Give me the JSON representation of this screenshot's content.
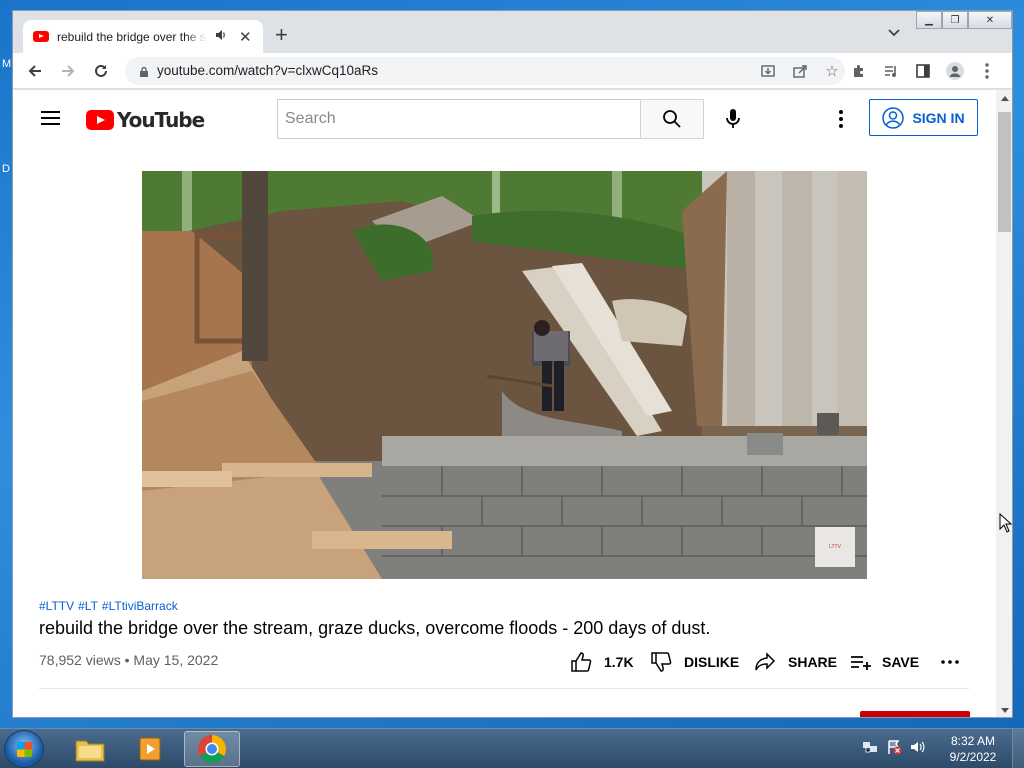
{
  "desktop": {
    "letters": [
      "M",
      "D"
    ]
  },
  "browser": {
    "tab": {
      "title": "rebuild the bridge over the stream, graze ducks, overcome floods - 200 days of dust. - YouTube"
    },
    "url": "youtube.com/watch?v=clxwCq10aRs"
  },
  "youtube": {
    "logo_text": "YouTube",
    "search_placeholder": "Search",
    "signin_label": "SIGN IN",
    "video": {
      "hashtags": [
        "#LTTV",
        "#LT",
        "#LTtiviBarrack"
      ],
      "title": "rebuild the bridge over the stream, graze ducks, overcome floods - 200 days of dust.",
      "views": "78,952 views",
      "date": "May 15, 2022",
      "meta_separator": "•",
      "likes": "1.7K",
      "dislike_label": "DISLIKE",
      "share_label": "SHARE",
      "save_label": "SAVE"
    }
  },
  "taskbar": {
    "time": "8:32 AM",
    "date": "9/2/2022"
  },
  "colors": {
    "yt_red": "#ff0000",
    "link_blue": "#065fd4",
    "desktop_blue": "#1a74c9"
  }
}
